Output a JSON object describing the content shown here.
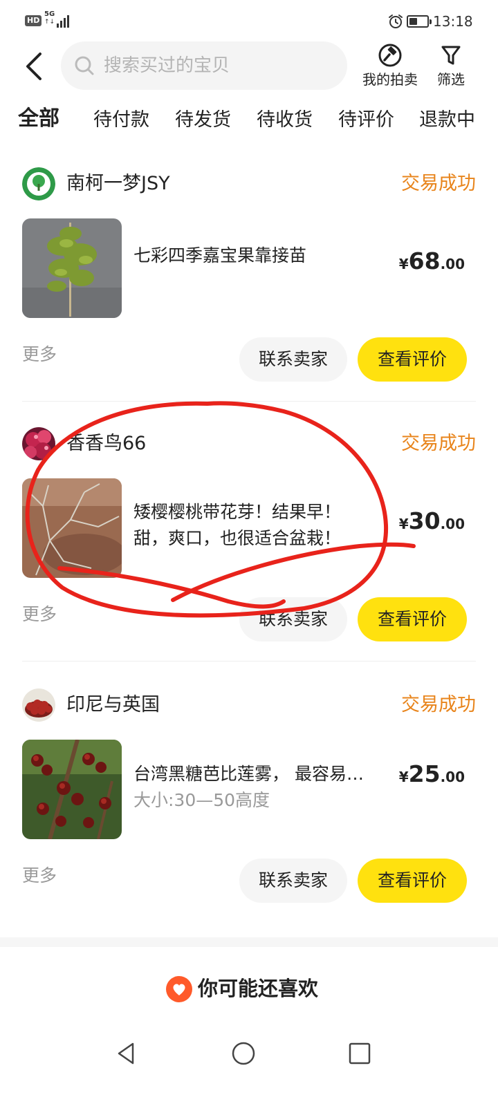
{
  "status_bar": {
    "hd_badge": "HD",
    "network": "5G",
    "network_arrows": "↑↓",
    "time": "13:18",
    "battery_level": 0.45
  },
  "header": {
    "back_icon": "chevron-left-icon",
    "search_placeholder": "搜索买过的宝贝",
    "auction_label": "我的拍卖",
    "filter_label": "筛选"
  },
  "tabs": [
    {
      "label": "全部",
      "active": true
    },
    {
      "label": "待付款",
      "active": false
    },
    {
      "label": "待发货",
      "active": false
    },
    {
      "label": "待收货",
      "active": false
    },
    {
      "label": "待评价",
      "active": false
    },
    {
      "label": "退款中",
      "active": false
    }
  ],
  "orders": [
    {
      "shop_name": "南柯一梦JSY",
      "status": "交易成功",
      "title": "七彩四季嘉宝果靠接苗",
      "spec": "",
      "currency": "¥",
      "price_int": "68",
      "price_dec": ".00",
      "more_label": "更多",
      "contact_label": "联系卖家",
      "review_label": "查看评价"
    },
    {
      "shop_name": "香香鸟66",
      "status": "交易成功",
      "title": "矮樱樱桃带花芽！结果早！甜，爽口，也很适合盆栽！",
      "spec": "",
      "currency": "¥",
      "price_int": "30",
      "price_dec": ".00",
      "more_label": "更多",
      "contact_label": "联系卖家",
      "review_label": "查看评价"
    },
    {
      "shop_name": "印尼与英国",
      "status": "交易成功",
      "title": "台湾黑糖芭比莲雾， 最容易…",
      "spec": "大小:30—50高度",
      "currency": "¥",
      "price_int": "25",
      "price_dec": ".00",
      "more_label": "更多",
      "contact_label": "联系卖家",
      "review_label": "查看评价"
    }
  ],
  "recommend": {
    "label": "你可能还喜欢",
    "icon": "heart-icon"
  },
  "colors": {
    "accent_yellow": "#ffe10f",
    "status_orange": "#e8841b",
    "annotation_red": "#e8231b",
    "recommend_icon": "#ff5a2a"
  }
}
